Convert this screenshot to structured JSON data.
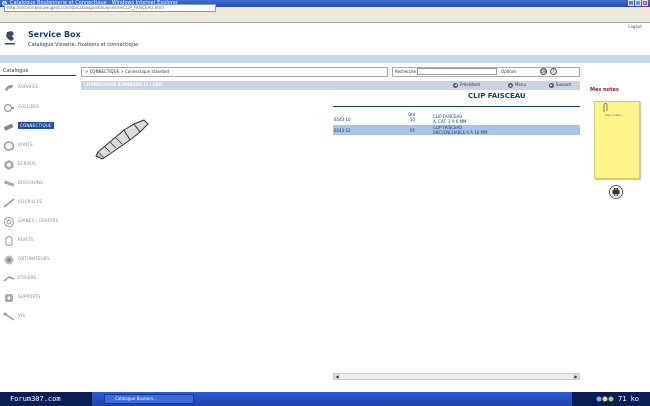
{
  "window": {
    "title": "Catalogue Boulonnerie et Connectique - Windows Internet Explorer",
    "url": "http://service.box.peugeot.com/sb/catalogue/boulonnerie/CLIP_FAISCEAU.html"
  },
  "header": {
    "app_title": "Service Box",
    "subtitle": "Catalogue Visserie, fixations et connectique",
    "logout": "Logout"
  },
  "sidebar": {
    "title": "Catalogue",
    "items": [
      {
        "label": "AGRAFES",
        "icon": "clip-icon"
      },
      {
        "label": "COLLIERS",
        "icon": "collar-icon"
      },
      {
        "label": "CONNECTIQUE",
        "icon": "connector-icon",
        "active": true
      },
      {
        "label": "JOINTS",
        "icon": "seal-icon"
      },
      {
        "label": "ECROUS",
        "icon": "nut-icon"
      },
      {
        "label": "BOUCHONS",
        "icon": "plug-icon"
      },
      {
        "label": "GOUPILLES",
        "icon": "pin-icon"
      },
      {
        "label": "GAINES / GRAFFES",
        "icon": "sheath-icon"
      },
      {
        "label": "RIVETS",
        "icon": "rivet-icon"
      },
      {
        "label": "OBTURATEURS",
        "icon": "cap-icon"
      },
      {
        "label": "ETRIERS",
        "icon": "bracket-icon"
      },
      {
        "label": "SUPPORTS",
        "icon": "support-icon"
      },
      {
        "label": "VIS",
        "icon": "screw-icon"
      }
    ]
  },
  "breadcrumb": "> CONNECTIQUE > Connectique standard",
  "search": {
    "label": "Recherche",
    "placeholder": "",
    "option": "Options",
    "go": "OK",
    "help": "?"
  },
  "section": {
    "title": "CONNECTIQUE STANDARD (1 / 148)",
    "prev": "Précédent",
    "menu": "Menu",
    "next": "Suivant"
  },
  "part": {
    "name": "CLIP FAISCEAU"
  },
  "table": {
    "header_qty": "Qté",
    "rows": [
      {
        "ref": "6543 10",
        "qty": "10",
        "desc1": "CLIP FAISCEAU",
        "desc2": "A. CAT. 3 A 6 MM",
        "selected": false
      },
      {
        "ref": "6543 12",
        "qty": "01",
        "desc1": "CLIP FAISCEAU",
        "desc2": "ENCLENCHABLE 6 A 10 MM",
        "selected": true
      }
    ]
  },
  "memo": {
    "title": "Mes notes",
    "note_text": "Mes notes ..."
  },
  "taskbar": {
    "start_label": "Forum307.com",
    "task_label": "Catalogue Boulonn...",
    "filesize": "71 ko"
  }
}
